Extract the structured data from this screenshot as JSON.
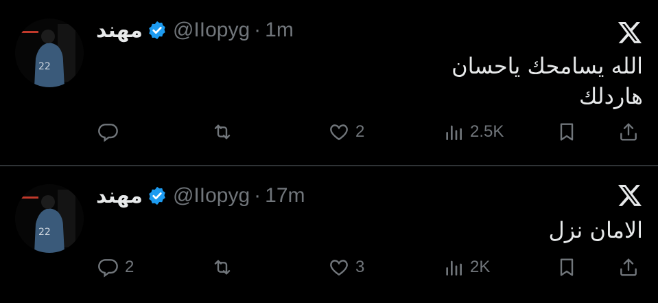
{
  "tweets": [
    {
      "display_name": "مهند",
      "handle": "@IIopyg",
      "separator": "·",
      "time": "1m",
      "text_lines": [
        "الله يسامحك ياحسان",
        "هاردلك"
      ],
      "replies": "",
      "reposts": "",
      "likes": "2",
      "views": "2.5K"
    },
    {
      "display_name": "مهند",
      "handle": "@IIopyg",
      "separator": "·",
      "time": "17m",
      "text_lines": [
        "الامان نزل"
      ],
      "replies": "2",
      "reposts": "",
      "likes": "3",
      "views": "2K"
    }
  ],
  "colors": {
    "background": "#000000",
    "text": "#e7e9ea",
    "secondary": "#71767b",
    "verified": "#1d9bf0",
    "divider": "#2f3336"
  },
  "icons": [
    "x-logo-icon",
    "verified-badge-icon",
    "reply-icon",
    "repost-icon",
    "like-icon",
    "views-icon",
    "bookmark-icon",
    "share-icon"
  ]
}
